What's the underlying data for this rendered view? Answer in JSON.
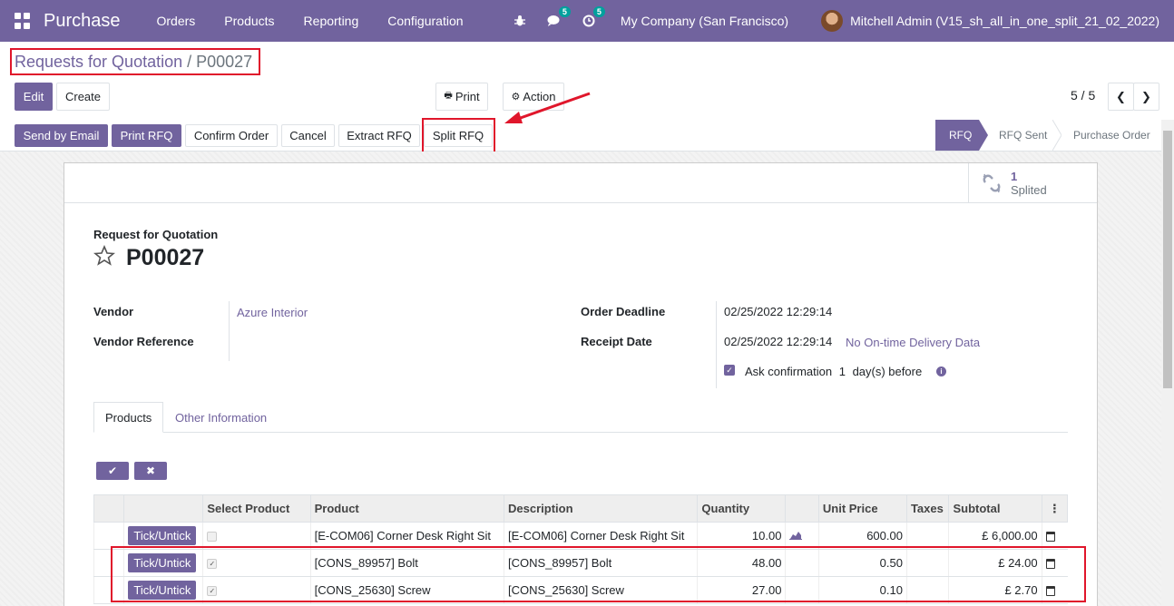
{
  "navbar": {
    "app_name": "Purchase",
    "menus": [
      "Orders",
      "Products",
      "Reporting",
      "Configuration"
    ],
    "messages_count": "5",
    "activities_count": "5",
    "company": "My Company (San Francisco)",
    "user": "Mitchell Admin (V15_sh_all_in_one_split_21_02_2022)"
  },
  "breadcrumb": {
    "parent": "Requests for Quotation",
    "separator": "/",
    "current": "P00027"
  },
  "toolbar": {
    "edit": "Edit",
    "create": "Create",
    "print": "Print",
    "action": "Action",
    "pager": "5 / 5"
  },
  "header_buttons": {
    "send_by_email": "Send by Email",
    "print_rfq": "Print RFQ",
    "confirm_order": "Confirm Order",
    "cancel": "Cancel",
    "extract_rfq": "Extract RFQ",
    "split_rfq": "Split RFQ"
  },
  "statusbar": {
    "stages": [
      "RFQ",
      "RFQ Sent",
      "Purchase Order"
    ],
    "active": "RFQ"
  },
  "smart_button": {
    "count": "1",
    "label": "Splited"
  },
  "form": {
    "doc_type": "Request for Quotation",
    "name": "P00027",
    "vendor_label": "Vendor",
    "vendor_value": "Azure Interior",
    "vendor_ref_label": "Vendor Reference",
    "order_deadline_label": "Order Deadline",
    "order_deadline_value": "02/25/2022 12:29:14",
    "receipt_date_label": "Receipt Date",
    "receipt_date_value": "02/25/2022 12:29:14",
    "on_time_link": "No On-time Delivery Data",
    "ask_confirmation_prefix": "Ask confirmation",
    "ask_confirmation_days": "1",
    "ask_confirmation_suffix": "day(s) before"
  },
  "tabs": {
    "products": "Products",
    "other_info": "Other Information"
  },
  "lines": {
    "headers": [
      "Select Product",
      "Product",
      "Description",
      "Quantity",
      "Unit Price",
      "Taxes",
      "Subtotal"
    ],
    "tick_label": "Tick/Untick",
    "rows": [
      {
        "product": "[E-COM06] Corner Desk Right Sit",
        "description": "[E-COM06] Corner Desk Right Sit",
        "quantity": "10.00",
        "unit_price": "600.00",
        "subtotal": "£ 6,000.00",
        "checked": false
      },
      {
        "product": "[CONS_89957] Bolt",
        "description": "[CONS_89957] Bolt",
        "quantity": "48.00",
        "unit_price": "0.50",
        "subtotal": "£ 24.00",
        "checked": true
      },
      {
        "product": "[CONS_25630] Screw",
        "description": "[CONS_25630] Screw",
        "quantity": "27.00",
        "unit_price": "0.10",
        "subtotal": "£ 2.70",
        "checked": true
      }
    ]
  },
  "colors": {
    "brand": "#71639e",
    "highlight": "#e0162b"
  }
}
